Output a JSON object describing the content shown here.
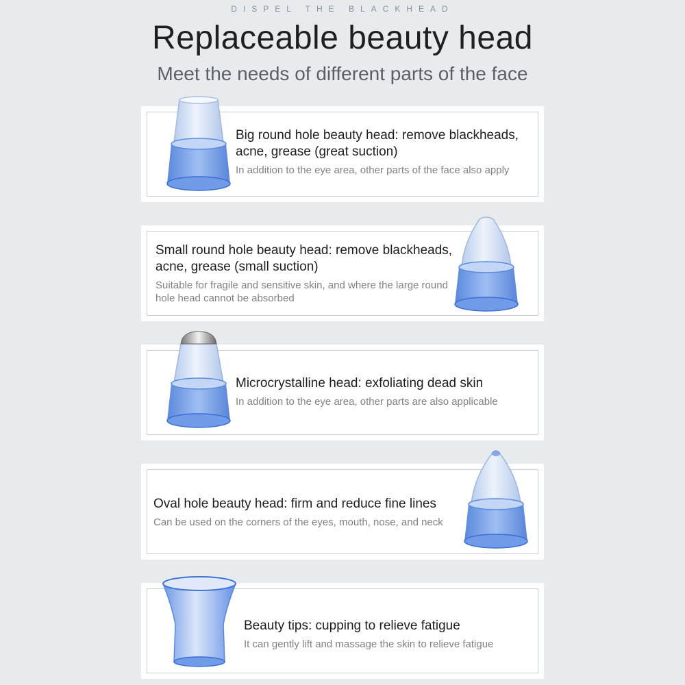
{
  "header": {
    "tagline": "DISPEL THE BLACKHEAD",
    "title": "Replaceable beauty head",
    "subtitle": "Meet the needs of different parts of the face"
  },
  "items": [
    {
      "heading": "Big round hole beauty head: remove blackheads, acne, grease (great suction)",
      "description": "In addition to the eye area, other parts of the face also apply",
      "icon": "big-round-hole-head-icon"
    },
    {
      "heading": "Small round hole beauty head: remove blackheads, acne, grease (small suction)",
      "description": "Suitable for fragile and sensitive skin, and where the large round hole head cannot be absorbed",
      "icon": "small-round-hole-head-icon"
    },
    {
      "heading": "Microcrystalline head: exfoliating dead skin",
      "description": "In addition to the eye area, other parts are also applicable",
      "icon": "microcrystalline-head-icon"
    },
    {
      "heading": "Oval hole beauty head: firm and reduce fine lines",
      "description": "Can be used on the corners of the eyes, mouth, nose, and neck",
      "icon": "oval-hole-head-icon"
    },
    {
      "heading": "Beauty tips: cupping to relieve fatigue",
      "description": "It can gently lift and massage the skin to relieve fatigue",
      "icon": "cupping-head-icon"
    }
  ],
  "colors": {
    "background": "#e8ebee",
    "card": "#ffffff",
    "cup_blue": "#4f86e6",
    "title": "#1f1f1f"
  }
}
